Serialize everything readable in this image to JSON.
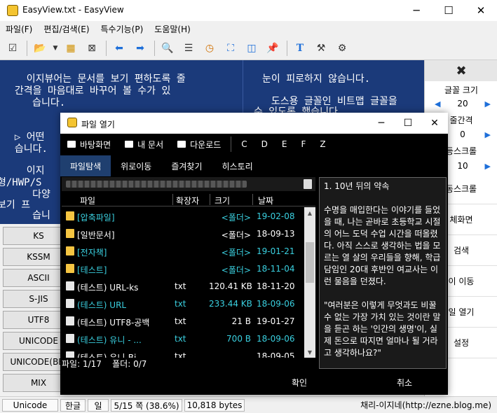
{
  "window": {
    "title": "EasyView.txt - EasyView",
    "minimize": "─",
    "maximize": "☐",
    "close": "✕"
  },
  "menu": [
    "파일(F)",
    "편집/검색(E)",
    "특수기능(P)",
    "도움말(H)"
  ],
  "toolbar": {
    "icons": [
      "checkbox-icon",
      "open-folder-icon",
      "dropdown-arrow-icon",
      "bookmark-icon",
      "close-doc-icon",
      "prev-arrow-icon",
      "next-arrow-icon",
      "search-icon",
      "list-icon",
      "clock-icon",
      "fullscreen-icon",
      "split-view-icon",
      "pin-icon",
      "font-icon",
      "tools-icon",
      "settings-icon"
    ]
  },
  "document": {
    "lines_left": [
      "    이지뷰어는 문서를 보기 편하도록 줄",
      "  간격을 마음대로 바꾸어 볼 수가 있",
      "     습니다.",
      "",
      "",
      "  ▷ 어떤",
      "  습니다.",
      "",
      "    이지",
      "형/HWP/S",
      "     다양",
      "보기 프",
      "     습니"
    ],
    "lines_right": [
      "눈이 피로하지 않습니다.",
      "",
      "  도스용 글꼴인 비트맵 글꼴을",
      "수 있도록 했습니다."
    ]
  },
  "right_panel": {
    "close": "✖",
    "font_size_label": "글꼴 크기",
    "font_size_value": "20",
    "line_spacing_label": "줄간격",
    "line_spacing_value": "0",
    "scroll_label": "등스크롤",
    "scroll_value": "10",
    "left_arrow": "◀",
    "right_arrow": "▶",
    "buttons": [
      "동스크롤",
      "체화면",
      "검색",
      "이 이동",
      "일 열기",
      "설정"
    ]
  },
  "encodings": [
    "KS",
    "KSSM",
    "ASCII",
    "S-JIS",
    "UTF8",
    "UNICODE",
    "UNICODE(BE)",
    "MIX"
  ],
  "statusbar": {
    "encoding": "Unicode",
    "lang": "한글",
    "mode": "일",
    "page": "5/15 쪽 (38.6%)",
    "bytes": "10,818 bytes",
    "link": "채리-이지네(http://ezne.blog.me)"
  },
  "dialog": {
    "title": "파일 열기",
    "minimize": "─",
    "maximize": "☐",
    "close": "✕",
    "drives": [
      "바탕화면",
      "내 문서",
      "다운로드"
    ],
    "letters": [
      "C",
      "D",
      "E",
      "F",
      "Z"
    ],
    "tabs": [
      "파일탐색",
      "위로이동",
      "즐겨찾기",
      "히스토리"
    ],
    "columns": [
      "파일",
      "확장자",
      "크기",
      "날짜"
    ],
    "files": [
      {
        "name": "[압축파일]",
        "ext": "",
        "size": "<폴더>",
        "date": "19-02-08",
        "folder": true,
        "color": "#3ad0e0"
      },
      {
        "name": "[일반문서]",
        "ext": "",
        "size": "<폴더>",
        "date": "18-09-13",
        "folder": true,
        "color": "#ffffff"
      },
      {
        "name": "[전자책]",
        "ext": "",
        "size": "<폴더>",
        "date": "19-01-21",
        "folder": true,
        "color": "#3ad0e0"
      },
      {
        "name": "[테스트]",
        "ext": "",
        "size": "<폴더>",
        "date": "18-11-04",
        "folder": true,
        "color": "#3ad0e0"
      },
      {
        "name": "(테스트) URL-ks",
        "ext": "txt",
        "size": "120.41 KB",
        "date": "18-11-20",
        "folder": false,
        "color": "#ffffff"
      },
      {
        "name": "(테스트) URL",
        "ext": "txt",
        "size": "233.44 KB",
        "date": "18-09-06",
        "folder": false,
        "color": "#3ad0e0"
      },
      {
        "name": "(테스트) UTF8-공백",
        "ext": "txt",
        "size": "21 B",
        "date": "19-01-27",
        "folder": false,
        "color": "#ffffff"
      },
      {
        "name": "(테스트) 유니 - ...",
        "ext": "txt",
        "size": "700 B",
        "date": "18-09-06",
        "folder": false,
        "color": "#3ad0e0"
      },
      {
        "name": "(테스트) 유니-Bi",
        "ext": "txt",
        "size": "",
        "date": "18-09-05",
        "folder": false,
        "color": "#ffffff"
      }
    ],
    "footer": "파일: 1/17    폴더: 0/7",
    "preview_title": "1. 10년 뒤의 약속",
    "preview_p1": "수명을 매입한다는 이야기를 들었을 때, 나는 곧바로 초등학교 시절의 어느 도덕 수업 시간을 떠올렸다. 아직 스스로 생각하는 법을 모르는 열 살의 우리들을 향해, 학급 담임인 20대 후반인 여교사는 이런 물음을 던졌다.",
    "preview_p2": "\"여러분은 이렇게 무엇과도 비꿀 수 없는 가장 가치 있는 것이란 말을 듣곤 하는 '인간의 생명'이, 실제 돈으로 따지면 얼마나 될 거라고 생각하나요?\"",
    "ok": "확인",
    "cancel": "취소"
  }
}
